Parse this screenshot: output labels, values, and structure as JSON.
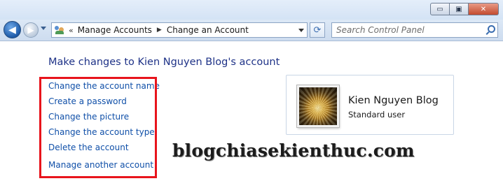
{
  "window": {
    "caption_minimize": "▭",
    "caption_maximize": "▣",
    "caption_close": "✕"
  },
  "navbar": {
    "back_glyph": "◀",
    "forward_glyph": "▶",
    "address_separator": "«",
    "breadcrumb": [
      "Manage Accounts",
      "Change an Account"
    ],
    "breadcrumb_arrow": "▶",
    "refresh_glyph": "⟳",
    "search_placeholder": "Search Control Panel"
  },
  "main": {
    "heading": "Make changes to Kien Nguyen Blog's account",
    "tasks": [
      "Change the account name",
      "Create a password",
      "Change the picture",
      "Change the account type",
      "Delete the account",
      "Manage another account"
    ],
    "highlight_color": "#e8141c"
  },
  "account": {
    "name": "Kien Nguyen Blog",
    "type": "Standard user"
  },
  "watermark": "blogchiasekienthuc.com",
  "icons": {
    "back": "back-arrow-icon",
    "forward": "forward-arrow-icon",
    "control_panel": "users-icon",
    "refresh": "refresh-icon",
    "search": "search-icon"
  },
  "colors": {
    "link": "#0f4fa8",
    "heading": "#1e3287",
    "nav_bg": "#d4e3f5"
  }
}
